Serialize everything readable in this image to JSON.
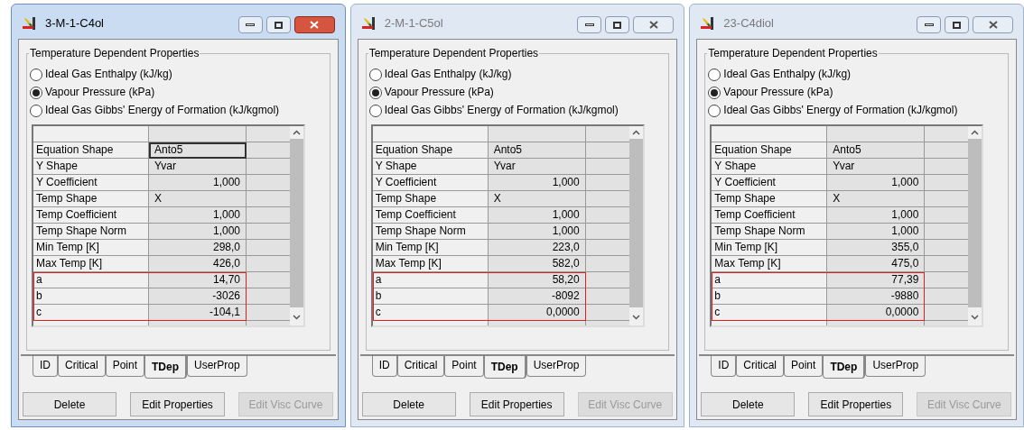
{
  "windows": [
    {
      "title": "3-M-1-C4ol",
      "active": true,
      "group_title": "Temperature Dependent Properties",
      "options": [
        {
          "label": "Ideal Gas Enthalpy (kJ/kg)",
          "selected": false
        },
        {
          "label": "Vapour Pressure (kPa)",
          "selected": true
        },
        {
          "label": "Ideal Gas Gibbs' Energy of Formation (kJ/kgmol)",
          "selected": false
        }
      ],
      "rows": [
        {
          "name": "Equation Shape",
          "value": "Anto5",
          "kind": "text",
          "focused": true,
          "highlighted": false
        },
        {
          "name": "Y Shape",
          "value": "Yvar",
          "kind": "text",
          "focused": false,
          "highlighted": false
        },
        {
          "name": "Y Coefficient",
          "value": "1,000",
          "kind": "number",
          "focused": false,
          "highlighted": false
        },
        {
          "name": "Temp Shape",
          "value": "X",
          "kind": "text",
          "focused": false,
          "highlighted": false
        },
        {
          "name": "Temp Coefficient",
          "value": "1,000",
          "kind": "number",
          "focused": false,
          "highlighted": false
        },
        {
          "name": "Temp Shape Norm",
          "value": "1,000",
          "kind": "number",
          "focused": false,
          "highlighted": false
        },
        {
          "name": "Min Temp [K]",
          "value": "298,0",
          "kind": "number",
          "focused": false,
          "highlighted": false
        },
        {
          "name": "Max Temp [K]",
          "value": "426,0",
          "kind": "number",
          "focused": false,
          "highlighted": false
        },
        {
          "name": "a",
          "value": "14,70",
          "kind": "number",
          "focused": false,
          "highlighted": true
        },
        {
          "name": "b",
          "value": "-3026",
          "kind": "number",
          "focused": false,
          "highlighted": true
        },
        {
          "name": "c",
          "value": "-104,1",
          "kind": "number",
          "focused": false,
          "highlighted": true
        }
      ],
      "tabs": [
        {
          "label": "ID",
          "selected": false
        },
        {
          "label": "Critical",
          "selected": false
        },
        {
          "label": "Point",
          "selected": false
        },
        {
          "label": "TDep",
          "selected": true
        },
        {
          "label": "UserProp",
          "selected": false
        }
      ],
      "buttons": [
        {
          "label": "Delete",
          "disabled": false
        },
        {
          "label": "Edit Properties",
          "disabled": false
        },
        {
          "label": "Edit Visc Curve",
          "disabled": true
        }
      ]
    },
    {
      "title": "2-M-1-C5ol",
      "active": false,
      "group_title": "Temperature Dependent Properties",
      "options": [
        {
          "label": "Ideal Gas Enthalpy (kJ/kg)",
          "selected": false
        },
        {
          "label": "Vapour Pressure (kPa)",
          "selected": true
        },
        {
          "label": "Ideal Gas Gibbs' Energy of Formation (kJ/kgmol)",
          "selected": false
        }
      ],
      "rows": [
        {
          "name": "Equation Shape",
          "value": "Anto5",
          "kind": "text",
          "focused": false,
          "highlighted": false
        },
        {
          "name": "Y Shape",
          "value": "Yvar",
          "kind": "text",
          "focused": false,
          "highlighted": false
        },
        {
          "name": "Y Coefficient",
          "value": "1,000",
          "kind": "number",
          "focused": false,
          "highlighted": false
        },
        {
          "name": "Temp Shape",
          "value": "X",
          "kind": "text",
          "focused": false,
          "highlighted": false
        },
        {
          "name": "Temp Coefficient",
          "value": "1,000",
          "kind": "number",
          "focused": false,
          "highlighted": false
        },
        {
          "name": "Temp Shape Norm",
          "value": "1,000",
          "kind": "number",
          "focused": false,
          "highlighted": false
        },
        {
          "name": "Min Temp [K]",
          "value": "223,0",
          "kind": "number",
          "focused": false,
          "highlighted": false
        },
        {
          "name": "Max Temp [K]",
          "value": "582,0",
          "kind": "number",
          "focused": false,
          "highlighted": false
        },
        {
          "name": "a",
          "value": "58,20",
          "kind": "number",
          "focused": false,
          "highlighted": true
        },
        {
          "name": "b",
          "value": "-8092",
          "kind": "number",
          "focused": false,
          "highlighted": true
        },
        {
          "name": "c",
          "value": "0,0000",
          "kind": "number",
          "focused": false,
          "highlighted": true
        }
      ],
      "tabs": [
        {
          "label": "ID",
          "selected": false
        },
        {
          "label": "Critical",
          "selected": false
        },
        {
          "label": "Point",
          "selected": false
        },
        {
          "label": "TDep",
          "selected": true
        },
        {
          "label": "UserProp",
          "selected": false
        }
      ],
      "buttons": [
        {
          "label": "Delete",
          "disabled": false
        },
        {
          "label": "Edit Properties",
          "disabled": false
        },
        {
          "label": "Edit Visc Curve",
          "disabled": true
        }
      ]
    },
    {
      "title": "23-C4diol",
      "active": false,
      "group_title": "Temperature Dependent Properties",
      "options": [
        {
          "label": "Ideal Gas Enthalpy (kJ/kg)",
          "selected": false
        },
        {
          "label": "Vapour Pressure (kPa)",
          "selected": true
        },
        {
          "label": "Ideal Gas Gibbs' Energy of Formation (kJ/kgmol)",
          "selected": false
        }
      ],
      "rows": [
        {
          "name": "Equation Shape",
          "value": "Anto5",
          "kind": "text",
          "focused": false,
          "highlighted": false
        },
        {
          "name": "Y Shape",
          "value": "Yvar",
          "kind": "text",
          "focused": false,
          "highlighted": false
        },
        {
          "name": "Y Coefficient",
          "value": "1,000",
          "kind": "number",
          "focused": false,
          "highlighted": false
        },
        {
          "name": "Temp Shape",
          "value": "X",
          "kind": "text",
          "focused": false,
          "highlighted": false
        },
        {
          "name": "Temp Coefficient",
          "value": "1,000",
          "kind": "number",
          "focused": false,
          "highlighted": false
        },
        {
          "name": "Temp Shape Norm",
          "value": "1,000",
          "kind": "number",
          "focused": false,
          "highlighted": false
        },
        {
          "name": "Min Temp [K]",
          "value": "355,0",
          "kind": "number",
          "focused": false,
          "highlighted": false
        },
        {
          "name": "Max Temp [K]",
          "value": "475,0",
          "kind": "number",
          "focused": false,
          "highlighted": false
        },
        {
          "name": "a",
          "value": "77,39",
          "kind": "number",
          "focused": false,
          "highlighted": true
        },
        {
          "name": "b",
          "value": "-9880",
          "kind": "number",
          "focused": false,
          "highlighted": true
        },
        {
          "name": "c",
          "value": "0,0000",
          "kind": "number",
          "focused": false,
          "highlighted": true
        }
      ],
      "tabs": [
        {
          "label": "ID",
          "selected": false
        },
        {
          "label": "Critical",
          "selected": false
        },
        {
          "label": "Point",
          "selected": false
        },
        {
          "label": "TDep",
          "selected": true
        },
        {
          "label": "UserProp",
          "selected": false
        }
      ],
      "buttons": [
        {
          "label": "Delete",
          "disabled": false
        },
        {
          "label": "Edit Properties",
          "disabled": false
        },
        {
          "label": "Edit Visc Curve",
          "disabled": true
        }
      ]
    }
  ]
}
